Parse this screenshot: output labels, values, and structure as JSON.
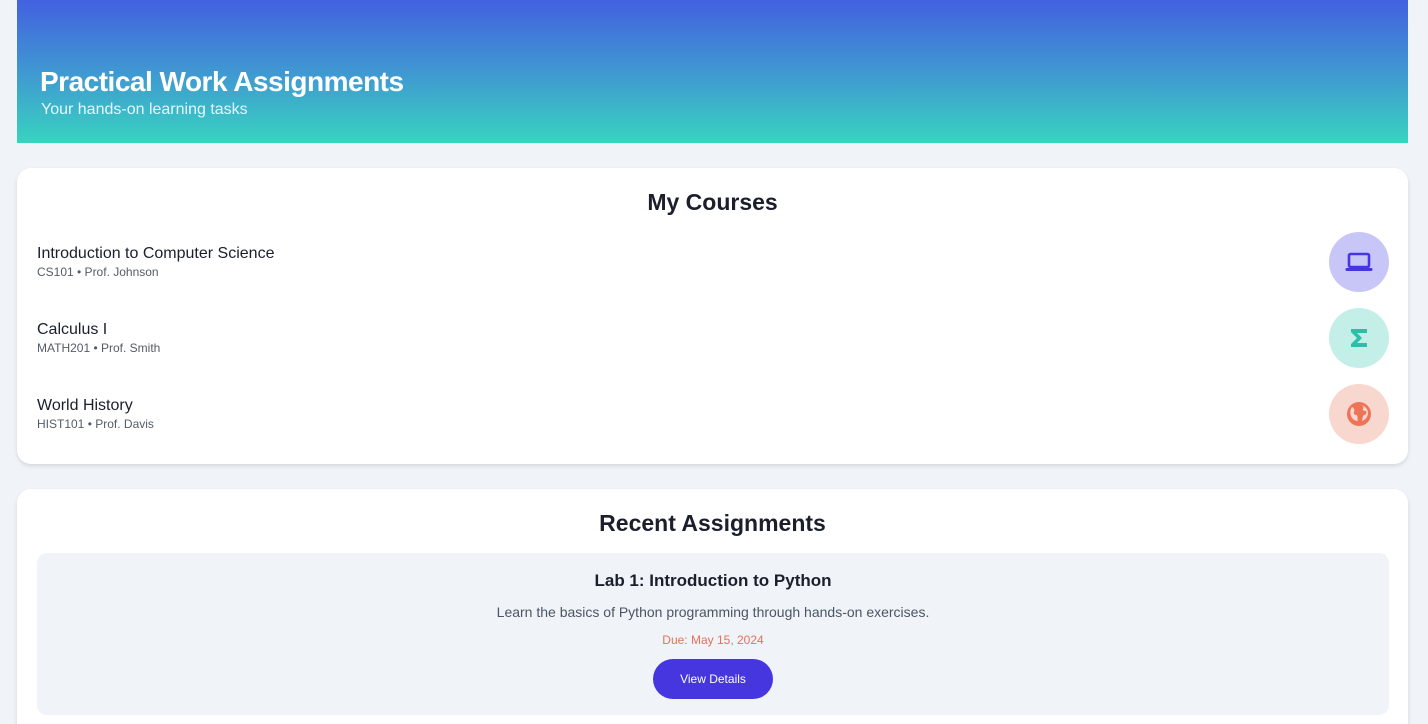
{
  "header": {
    "title": "Practical Work Assignments",
    "subtitle": "Your hands-on learning tasks"
  },
  "courses": {
    "title": "My Courses",
    "items": [
      {
        "name": "Introduction to Computer Science",
        "meta": "CS101 • Prof. Johnson",
        "icon": "laptop-icon",
        "icon_bg": "#c8c6f7",
        "icon_color": "#4536e0"
      },
      {
        "name": "Calculus I",
        "meta": "MATH201 • Prof. Smith",
        "icon": "sigma-icon",
        "icon_bg": "#c4efe9",
        "icon_color": "#2bbfa8"
      },
      {
        "name": "World History",
        "meta": "HIST101 • Prof. Davis",
        "icon": "globe-icon",
        "icon_bg": "#f8d8ce",
        "icon_color": "#ee7457"
      }
    ]
  },
  "assignments": {
    "title": "Recent Assignments",
    "items": [
      {
        "title": "Lab 1: Introduction to Python",
        "description": "Learn the basics of Python programming through hands-on exercises.",
        "due": "Due: May 15, 2024",
        "button_label": "View Details"
      }
    ]
  },
  "colors": {
    "accent": "#4536e0",
    "due": "#e4705a",
    "header_gradient_top": "#4361e0",
    "header_gradient_bottom": "#38d3c0",
    "page_background": "#f0f4f8"
  }
}
